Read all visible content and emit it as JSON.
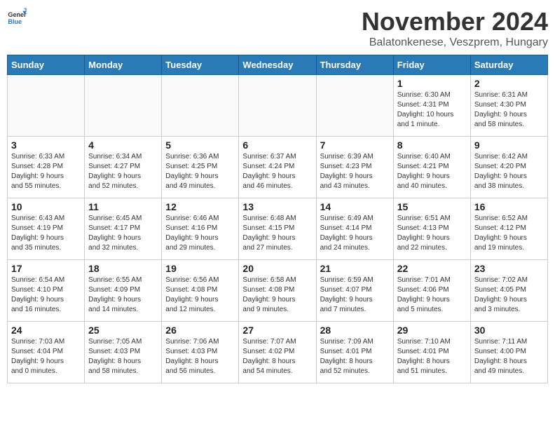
{
  "header": {
    "logo_general": "General",
    "logo_blue": "Blue",
    "month_title": "November 2024",
    "location": "Balatonkenese, Veszprem, Hungary"
  },
  "weekdays": [
    "Sunday",
    "Monday",
    "Tuesday",
    "Wednesday",
    "Thursday",
    "Friday",
    "Saturday"
  ],
  "weeks": [
    [
      {
        "day": "",
        "info": ""
      },
      {
        "day": "",
        "info": ""
      },
      {
        "day": "",
        "info": ""
      },
      {
        "day": "",
        "info": ""
      },
      {
        "day": "",
        "info": ""
      },
      {
        "day": "1",
        "info": "Sunrise: 6:30 AM\nSunset: 4:31 PM\nDaylight: 10 hours\nand 1 minute."
      },
      {
        "day": "2",
        "info": "Sunrise: 6:31 AM\nSunset: 4:30 PM\nDaylight: 9 hours\nand 58 minutes."
      }
    ],
    [
      {
        "day": "3",
        "info": "Sunrise: 6:33 AM\nSunset: 4:28 PM\nDaylight: 9 hours\nand 55 minutes."
      },
      {
        "day": "4",
        "info": "Sunrise: 6:34 AM\nSunset: 4:27 PM\nDaylight: 9 hours\nand 52 minutes."
      },
      {
        "day": "5",
        "info": "Sunrise: 6:36 AM\nSunset: 4:25 PM\nDaylight: 9 hours\nand 49 minutes."
      },
      {
        "day": "6",
        "info": "Sunrise: 6:37 AM\nSunset: 4:24 PM\nDaylight: 9 hours\nand 46 minutes."
      },
      {
        "day": "7",
        "info": "Sunrise: 6:39 AM\nSunset: 4:23 PM\nDaylight: 9 hours\nand 43 minutes."
      },
      {
        "day": "8",
        "info": "Sunrise: 6:40 AM\nSunset: 4:21 PM\nDaylight: 9 hours\nand 40 minutes."
      },
      {
        "day": "9",
        "info": "Sunrise: 6:42 AM\nSunset: 4:20 PM\nDaylight: 9 hours\nand 38 minutes."
      }
    ],
    [
      {
        "day": "10",
        "info": "Sunrise: 6:43 AM\nSunset: 4:19 PM\nDaylight: 9 hours\nand 35 minutes."
      },
      {
        "day": "11",
        "info": "Sunrise: 6:45 AM\nSunset: 4:17 PM\nDaylight: 9 hours\nand 32 minutes."
      },
      {
        "day": "12",
        "info": "Sunrise: 6:46 AM\nSunset: 4:16 PM\nDaylight: 9 hours\nand 29 minutes."
      },
      {
        "day": "13",
        "info": "Sunrise: 6:48 AM\nSunset: 4:15 PM\nDaylight: 9 hours\nand 27 minutes."
      },
      {
        "day": "14",
        "info": "Sunrise: 6:49 AM\nSunset: 4:14 PM\nDaylight: 9 hours\nand 24 minutes."
      },
      {
        "day": "15",
        "info": "Sunrise: 6:51 AM\nSunset: 4:13 PM\nDaylight: 9 hours\nand 22 minutes."
      },
      {
        "day": "16",
        "info": "Sunrise: 6:52 AM\nSunset: 4:12 PM\nDaylight: 9 hours\nand 19 minutes."
      }
    ],
    [
      {
        "day": "17",
        "info": "Sunrise: 6:54 AM\nSunset: 4:10 PM\nDaylight: 9 hours\nand 16 minutes."
      },
      {
        "day": "18",
        "info": "Sunrise: 6:55 AM\nSunset: 4:09 PM\nDaylight: 9 hours\nand 14 minutes."
      },
      {
        "day": "19",
        "info": "Sunrise: 6:56 AM\nSunset: 4:08 PM\nDaylight: 9 hours\nand 12 minutes."
      },
      {
        "day": "20",
        "info": "Sunrise: 6:58 AM\nSunset: 4:08 PM\nDaylight: 9 hours\nand 9 minutes."
      },
      {
        "day": "21",
        "info": "Sunrise: 6:59 AM\nSunset: 4:07 PM\nDaylight: 9 hours\nand 7 minutes."
      },
      {
        "day": "22",
        "info": "Sunrise: 7:01 AM\nSunset: 4:06 PM\nDaylight: 9 hours\nand 5 minutes."
      },
      {
        "day": "23",
        "info": "Sunrise: 7:02 AM\nSunset: 4:05 PM\nDaylight: 9 hours\nand 3 minutes."
      }
    ],
    [
      {
        "day": "24",
        "info": "Sunrise: 7:03 AM\nSunset: 4:04 PM\nDaylight: 9 hours\nand 0 minutes."
      },
      {
        "day": "25",
        "info": "Sunrise: 7:05 AM\nSunset: 4:03 PM\nDaylight: 8 hours\nand 58 minutes."
      },
      {
        "day": "26",
        "info": "Sunrise: 7:06 AM\nSunset: 4:03 PM\nDaylight: 8 hours\nand 56 minutes."
      },
      {
        "day": "27",
        "info": "Sunrise: 7:07 AM\nSunset: 4:02 PM\nDaylight: 8 hours\nand 54 minutes."
      },
      {
        "day": "28",
        "info": "Sunrise: 7:09 AM\nSunset: 4:01 PM\nDaylight: 8 hours\nand 52 minutes."
      },
      {
        "day": "29",
        "info": "Sunrise: 7:10 AM\nSunset: 4:01 PM\nDaylight: 8 hours\nand 51 minutes."
      },
      {
        "day": "30",
        "info": "Sunrise: 7:11 AM\nSunset: 4:00 PM\nDaylight: 8 hours\nand 49 minutes."
      }
    ]
  ]
}
